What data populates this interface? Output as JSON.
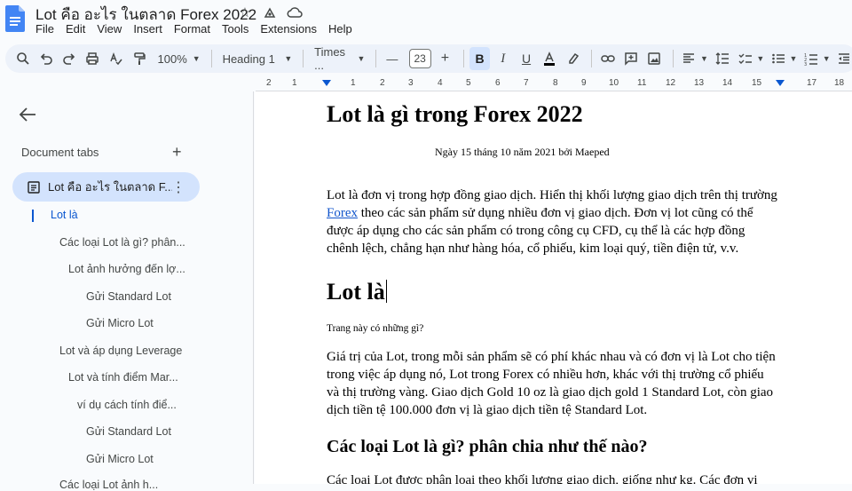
{
  "app": {
    "doc_title": "Lot คือ อะไร ในตลาด Forex 2022",
    "menu": [
      "File",
      "Edit",
      "View",
      "Insert",
      "Format",
      "Tools",
      "Extensions",
      "Help"
    ]
  },
  "toolbar": {
    "zoom": "100%",
    "style": "Heading 1",
    "font": "Times ...",
    "font_size": "23",
    "minus": "—",
    "plus": "+"
  },
  "ruler": {
    "ticks": [
      "2",
      "1",
      "1",
      "2",
      "3",
      "4",
      "5",
      "6",
      "7",
      "8",
      "9",
      "10",
      "11",
      "12",
      "13",
      "14",
      "15",
      "16",
      "17",
      "18"
    ]
  },
  "sidebar": {
    "tabs_header": "Document tabs",
    "active_tab": "Lot คือ อะไร ในตลาด F...",
    "outline": [
      "Lot là",
      "Các loại Lot là gì? phân...",
      "Lot ảnh hưởng đến lợ...",
      "Gửi Standard Lot",
      "Gửi Micro Lot",
      "Lot và áp dụng Leverage",
      "Lot và tính điểm Mar...",
      "ví dụ cách tính điể...",
      "Gửi Standard Lot",
      "Gửi Micro Lot",
      "Các loại Lot ảnh h..."
    ]
  },
  "document": {
    "title": "Lot là gì trong Forex 2022",
    "byline": "Ngày 15 tháng 10 năm 2021 bởi  Maeped",
    "para1_before_link": "Lot là đơn vị trong hợp đồng giao dịch. Hiển thị khối lượng giao dịch trên thị trường ",
    "para1_link": "Forex",
    "para1_after_link": " theo các sản phẩm sử dụng nhiều đơn vị giao dịch. Đơn vị lot cũng có thể được áp dụng cho các sản phẩm có trong công cụ CFD, cụ thể là các hợp đồng chênh lệch, chẳng hạn như hàng hóa, cổ phiếu, kim loại quý, tiền điện tử, v.v.",
    "heading_lot": "Lot là",
    "small_note": "Trang này có những gì?",
    "para2": "Giá trị của Lot, trong mỗi sản phẩm sẽ có phí khác nhau và có đơn vị là Lot cho tiện trong việc áp dụng nó, Lot trong Forex có nhiều hơn, khác với thị trường cổ phiếu và thị trường vàng. Giao dịch Gold 10 oz là giao dịch gold 1 Standard Lot, còn giao dịch tiền tệ 100.000 đơn vị là giao dịch tiền tệ Standard Lot.",
    "heading2": "Các loại Lot là gì? phân chia như thế nào?",
    "para3": "Các loại Lot được phân loại theo khối lượng giao dịch, giống như kg. Các đơn vị được"
  }
}
